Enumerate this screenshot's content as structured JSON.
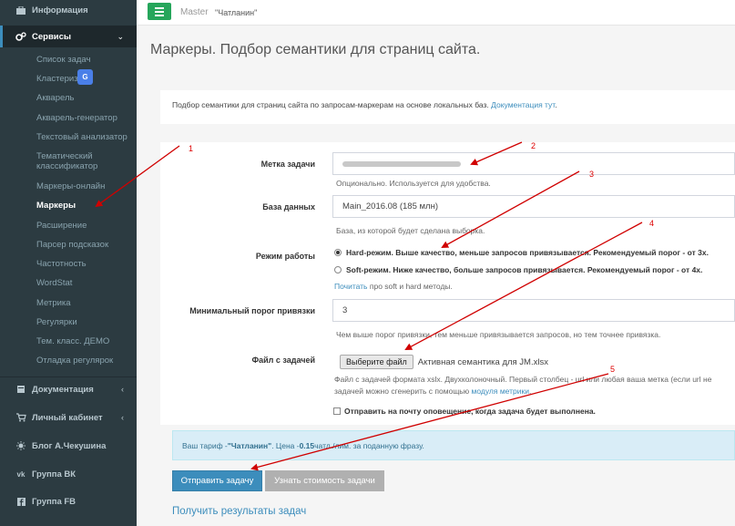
{
  "sidebar": {
    "top_items": [
      {
        "label": "Информация",
        "icon": "briefcase-icon"
      },
      {
        "label": "Сервисы",
        "icon": "gears-icon",
        "chevron": "⌄"
      }
    ],
    "sub_items": [
      "Список задач",
      "Кластериз",
      "Акварель",
      "Акварель-генератор",
      "Текстовый анализатор",
      "Тематический классификатор",
      "Маркеры-онлайн",
      "Маркеры",
      "Расширение",
      "Парсер подсказок",
      "Частотность",
      "WordStat",
      "Метрика",
      "Регулярки",
      "Тем. класс. ДЕМО",
      "Отладка регулярок"
    ],
    "bottom_items": [
      {
        "label": "Документация",
        "icon": "book-icon",
        "chevron": "‹"
      },
      {
        "label": "Личный кабинет",
        "icon": "cart-icon",
        "chevron": "‹"
      },
      {
        "label": "Блог А.Чекушина",
        "icon": "sun-icon"
      },
      {
        "label": "Группа ВК",
        "icon": "vk-icon"
      },
      {
        "label": "Группа FB",
        "icon": "facebook-icon"
      }
    ],
    "translate_badge": "G"
  },
  "header": {
    "breadcrumb_master": "Master",
    "breadcrumb_name": "\"Чатланин\""
  },
  "page": {
    "title": "Маркеры. Подбор семантики для страниц сайта.",
    "intro_text": "Подбор семантики для страниц сайта по запросам-маркерам на основе локальных баз. ",
    "intro_link": "Документация тут",
    "intro_end": "."
  },
  "form": {
    "task_label": {
      "label": "Метка задачи",
      "help": "Опционально. Используется для удобства."
    },
    "database": {
      "label": "База данных",
      "value": "Main_2016.08 (185 млн)",
      "help": "База, из которой будет сделана выборка."
    },
    "mode": {
      "label": "Режим работы",
      "options": [
        "Hard-режим. Выше качество, меньше запросов привязывается. Рекомендуемый порог - от 3х.",
        "Soft-режим. Ниже качество, больше запросов привязывается. Рекомендуемый порог - от 4х."
      ],
      "help_link": "Почитать",
      "help_rest": " про soft и hard методы."
    },
    "threshold": {
      "label": "Минимальный порог привязки",
      "value": "3",
      "help": "Чем выше порог привязки, тем меньше привязывается запросов, но тем точнее привязка."
    },
    "file": {
      "label": "Файл с задачей",
      "button": "Выберите файл",
      "filename": "Активная семантика для JM.xlsx",
      "help_line1": "Файл с задачей формата xslx. Двухколоночный. Первый столбец - url или любая ваша метка (если url не",
      "help_line2_pre": "задачей можно сгенерить с помощью ",
      "help_line2_link": "модуля метрики",
      "help_line2_end": "."
    },
    "notify": "Отправить на почту оповещение, когда задача будет выполнена."
  },
  "tariff": {
    "pre": "Ваш тариф - ",
    "name": "\"Чатланин\"",
    "mid": ". Цена - ",
    "price": "0.15",
    "post": " чатл./лим. за поданную фразу."
  },
  "buttons": {
    "submit": "Отправить задачу",
    "estimate": "Узнать стоимость задачи"
  },
  "results_link": "Получить результаты задач",
  "annotations": [
    "1",
    "2",
    "3",
    "4",
    "5"
  ],
  "colors": {
    "sidebar_bg": "#2c3b41",
    "accent": "#3c8dbc",
    "menu_button": "#26a65b",
    "arrow": "#d00000"
  }
}
